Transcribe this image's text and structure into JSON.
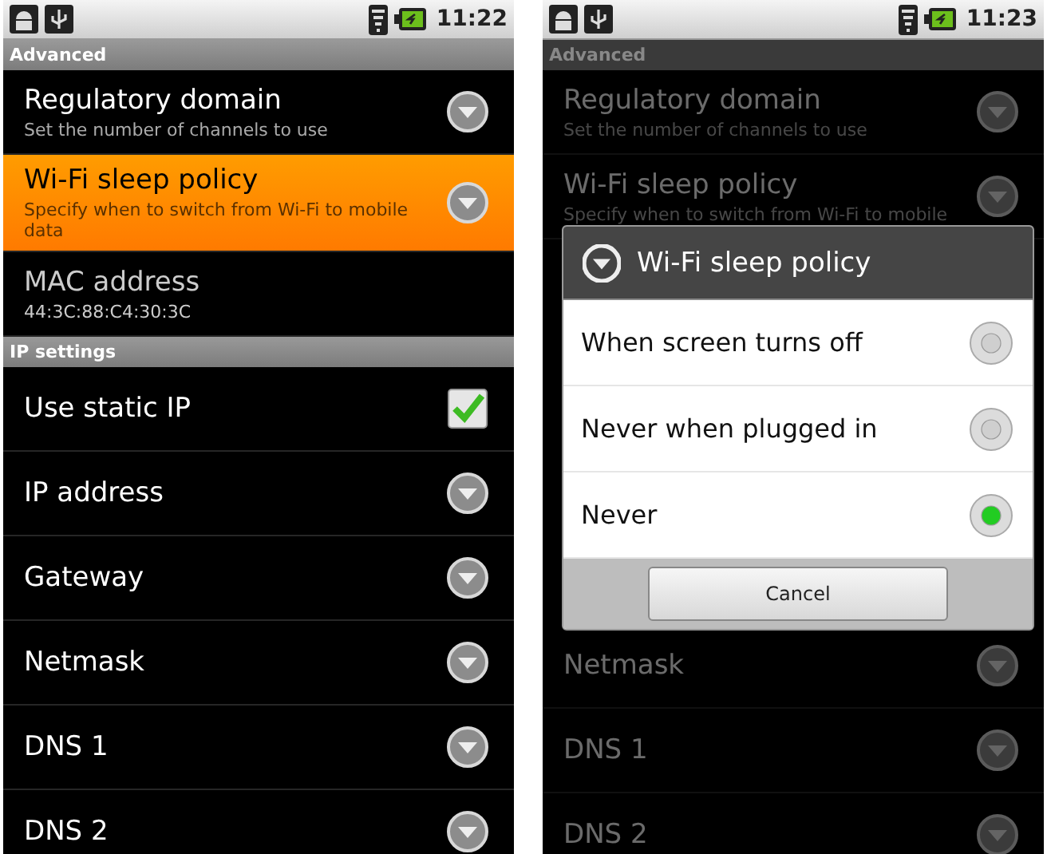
{
  "screens": [
    {
      "status_time": "11:22",
      "dimmed": false,
      "items": [
        {
          "kind": "header",
          "title": "Advanced"
        },
        {
          "kind": "dropdown",
          "title": "Regulatory domain",
          "summary": "Set the number of channels to use",
          "selected": false
        },
        {
          "kind": "dropdown",
          "title": "Wi-Fi sleep policy",
          "summary": "Specify when to switch from Wi-Fi to mobile data",
          "selected": true
        },
        {
          "kind": "info",
          "title": "MAC address",
          "summary": "44:3C:88:C4:30:3C",
          "selected": false
        },
        {
          "kind": "header",
          "title": "IP settings"
        },
        {
          "kind": "checkbox",
          "title": "Use static IP",
          "checked": true,
          "selected": false
        },
        {
          "kind": "dropdown",
          "title": "IP address",
          "selected": false
        },
        {
          "kind": "dropdown",
          "title": "Gateway",
          "selected": false
        },
        {
          "kind": "dropdown",
          "title": "Netmask",
          "selected": false
        },
        {
          "kind": "dropdown",
          "title": "DNS 1",
          "selected": false
        },
        {
          "kind": "dropdown",
          "title": "DNS 2",
          "selected": false
        }
      ]
    },
    {
      "status_time": "11:23",
      "dimmed": true,
      "items": [
        {
          "kind": "header",
          "title": "Advanced"
        },
        {
          "kind": "dropdown",
          "title": "Regulatory domain",
          "summary": "Set the number of channels to use",
          "selected": false
        },
        {
          "kind": "dropdown",
          "title": "Wi-Fi sleep policy",
          "summary": "Specify when to switch from Wi-Fi to mobile",
          "selected": false
        }
      ],
      "dialog": {
        "title": "Wi-Fi sleep policy",
        "options": [
          {
            "label": "When screen turns off",
            "selected": false
          },
          {
            "label": "Never when plugged in",
            "selected": false
          },
          {
            "label": "Never",
            "selected": true
          }
        ],
        "button": "Cancel"
      },
      "items_below_dialog": [
        {
          "kind": "dropdown",
          "title": "Netmask",
          "selected": false
        },
        {
          "kind": "dropdown",
          "title": "DNS 1",
          "selected": false
        },
        {
          "kind": "dropdown",
          "title": "DNS 2",
          "selected": false
        }
      ]
    }
  ]
}
